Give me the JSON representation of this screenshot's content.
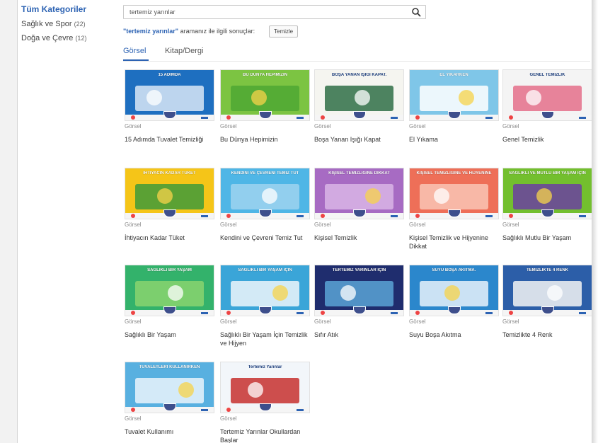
{
  "sidebar": {
    "all_label": "Tüm Kategoriler",
    "categories": [
      {
        "label": "Sağlık ve Spor",
        "count": "(22)"
      },
      {
        "label": "Doğa ve Çevre",
        "count": "(12)"
      }
    ]
  },
  "search": {
    "value": "tertemiz yarınlar",
    "icon": "search-icon"
  },
  "results": {
    "query": "\"tertemiz yarınlar\"",
    "suffix": "aramanız ile ilgili sonuçlar:",
    "clear_label": "Temizle"
  },
  "tabs": [
    {
      "label": "Görsel",
      "active": true
    },
    {
      "label": "Kitap/Dergi",
      "active": false
    }
  ],
  "items": [
    {
      "type": "Görsel",
      "title": "15 Adımda Tuvalet Temizliği",
      "banner": "15 ADIMDA",
      "bg": "#1e6fc0",
      "bg2": "#d9e8f6"
    },
    {
      "type": "Görsel",
      "title": "Bu Dünya Hepimizin",
      "banner": "BU DÜNYA HEPİMİZİN",
      "bg": "#7cc442",
      "bg2": "#4fa832"
    },
    {
      "type": "Görsel",
      "title": "Boşa Yanan Işığı Kapat",
      "banner": "BOŞA YANAN IŞIĞI KAPAT.",
      "bg": "#f5f5f0",
      "bg2": "#2f6f47"
    },
    {
      "type": "Görsel",
      "title": "El Yıkama",
      "banner": "EL YIKARKEN",
      "bg": "#7fc6e8",
      "bg2": "#ffffff"
    },
    {
      "type": "Görsel",
      "title": "Genel Temizlik",
      "banner": "GENEL TEMİZLİK",
      "bg": "#f4f4f4",
      "bg2": "#e46e8a"
    },
    {
      "type": "Görsel",
      "title": "İhtiyacın Kadar Tüket",
      "banner": "İHTİYACIN KADAR TÜKET",
      "bg": "#f5c518",
      "bg2": "#3f9a3a"
    },
    {
      "type": "Görsel",
      "title": "Kendini ve Çevreni Temiz Tut",
      "banner": "KENDİNİ VE ÇEVRENİ TEMİZ TUT",
      "bg": "#4fb6e6",
      "bg2": "#9ed3ef"
    },
    {
      "type": "Görsel",
      "title": "Kişisel Temizlik",
      "banner": "KİŞİSEL TEMİZLİĞİNE DİKKAT",
      "bg": "#a76bc3",
      "bg2": "#d9b5e6"
    },
    {
      "type": "Görsel",
      "title": "Kişisel Temizlik ve Hijyenine Dikkat",
      "banner": "KİŞİSEL TEMİZLİĞİNE VE HİJYENİNE",
      "bg": "#ee6f58",
      "bg2": "#f9c6b5"
    },
    {
      "type": "Görsel",
      "title": "Sağlıklı Mutlu Bir Yaşam",
      "banner": "SAĞLIKLI VE MUTLU BİR YAŞAM İÇİN",
      "bg": "#73bf2e",
      "bg2": "#6b3fa0"
    },
    {
      "type": "Görsel",
      "title": "Sağlıklı Bir Yaşam",
      "banner": "SAĞLIKLI BİR YAŞAM",
      "bg": "#33b26b",
      "bg2": "#8ad36f"
    },
    {
      "type": "Görsel",
      "title": "Sağlıklı Bir Yaşam İçin Temizlik ve Hijyen",
      "banner": "SAĞLIKLI BİR YAŞAM İÇİN",
      "bg": "#3aa5d8",
      "bg2": "#eef6fb"
    },
    {
      "type": "Görsel",
      "title": "Sıfır Atık",
      "banner": "TERTEMİZ YARINLAR İÇİN",
      "bg": "#1f2d6e",
      "bg2": "#5ba4d6"
    },
    {
      "type": "Görsel",
      "title": "Suyu Boşa Akıtma",
      "banner": "SUYU BOŞA AKITMA.",
      "bg": "#2b87cc",
      "bg2": "#e8f2fa"
    },
    {
      "type": "Görsel",
      "title": "Temizlikte 4 Renk",
      "banner": "TEMİZLİKTE 4 RENK",
      "bg": "#2c5ea8",
      "bg2": "#f4f4f4"
    },
    {
      "type": "Görsel",
      "title": "Tuvalet Kullanımı",
      "banner": "TUVALETLERİ KULLANIRKEN",
      "bg": "#58b0e0",
      "bg2": "#eaf5fb"
    },
    {
      "type": "Görsel",
      "title": "Tertemiz Yarınlar Okullardan Başlar",
      "banner": "Tertemiz Yarınlar",
      "bg": "#f2f6fa",
      "bg2": "#c7302e"
    }
  ]
}
